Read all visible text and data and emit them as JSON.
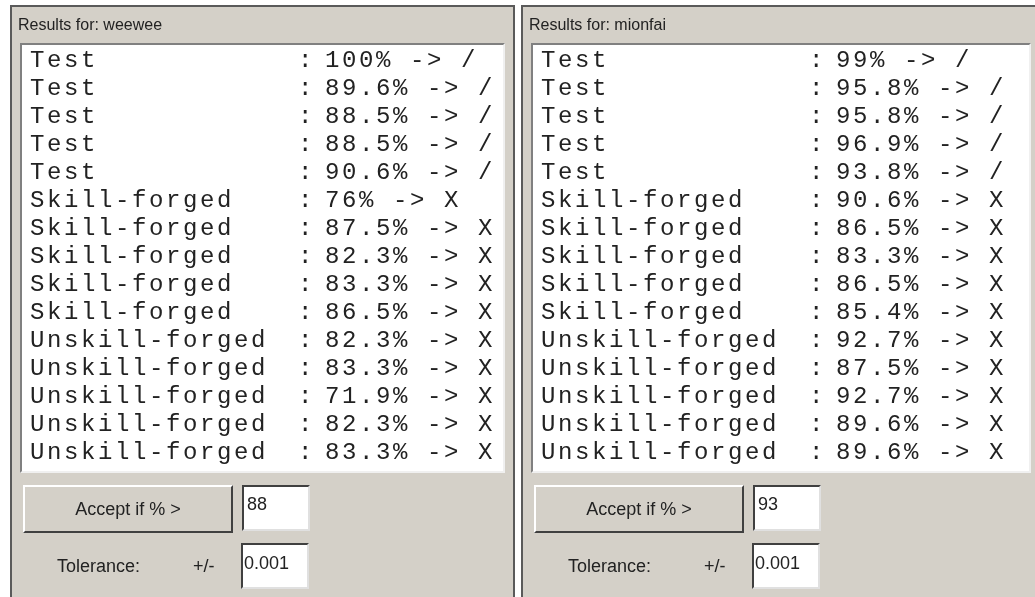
{
  "panels": [
    {
      "title": "Results for: weewee",
      "rows": [
        {
          "label": "Test",
          "separator": ":",
          "value": "100% -> /"
        },
        {
          "label": "Test",
          "separator": ":",
          "value": "89.6% -> /"
        },
        {
          "label": "Test",
          "separator": ":",
          "value": "88.5% -> /"
        },
        {
          "label": "Test",
          "separator": ":",
          "value": "88.5% -> /"
        },
        {
          "label": "Test",
          "separator": ":",
          "value": "90.6% -> /"
        },
        {
          "label": "Skill-forged",
          "separator": ":",
          "value": "76% -> X"
        },
        {
          "label": "Skill-forged",
          "separator": ":",
          "value": "87.5% -> X"
        },
        {
          "label": "Skill-forged",
          "separator": ":",
          "value": "82.3% -> X"
        },
        {
          "label": "Skill-forged",
          "separator": ":",
          "value": "83.3% -> X"
        },
        {
          "label": "Skill-forged",
          "separator": ":",
          "value": "86.5% -> X"
        },
        {
          "label": "Unskill-forged",
          "separator": ":",
          "value": "82.3% -> X"
        },
        {
          "label": "Unskill-forged",
          "separator": ":",
          "value": "83.3% -> X"
        },
        {
          "label": "Unskill-forged",
          "separator": ":",
          "value": "71.9% -> X"
        },
        {
          "label": "Unskill-forged",
          "separator": ":",
          "value": "82.3% -> X"
        },
        {
          "label": "Unskill-forged",
          "separator": ":",
          "value": "83.3% -> X"
        }
      ],
      "accept_button": "Accept if % >",
      "threshold": "88",
      "tolerance_label": "Tolerance:",
      "tolerance_prefix": "+/-",
      "tolerance": "0.001"
    },
    {
      "title": "Results for: mionfai",
      "rows": [
        {
          "label": "Test",
          "separator": ":",
          "value": "99% -> /"
        },
        {
          "label": "Test",
          "separator": ":",
          "value": "95.8% -> /"
        },
        {
          "label": "Test",
          "separator": ":",
          "value": "95.8% -> /"
        },
        {
          "label": "Test",
          "separator": ":",
          "value": "96.9% -> /"
        },
        {
          "label": "Test",
          "separator": ":",
          "value": "93.8% -> /"
        },
        {
          "label": "Skill-forged",
          "separator": ":",
          "value": "90.6% -> X"
        },
        {
          "label": "Skill-forged",
          "separator": ":",
          "value": "86.5% -> X"
        },
        {
          "label": "Skill-forged",
          "separator": ":",
          "value": "83.3% -> X"
        },
        {
          "label": "Skill-forged",
          "separator": ":",
          "value": "86.5% -> X"
        },
        {
          "label": "Skill-forged",
          "separator": ":",
          "value": "85.4% -> X"
        },
        {
          "label": "Unskill-forged",
          "separator": ":",
          "value": "92.7% -> X"
        },
        {
          "label": "Unskill-forged",
          "separator": ":",
          "value": "87.5% -> X"
        },
        {
          "label": "Unskill-forged",
          "separator": ":",
          "value": "92.7% -> X"
        },
        {
          "label": "Unskill-forged",
          "separator": ":",
          "value": "89.6% -> X"
        },
        {
          "label": "Unskill-forged",
          "separator": ":",
          "value": "89.6% -> X"
        }
      ],
      "accept_button": "Accept if % >",
      "threshold": "93",
      "tolerance_label": "Tolerance:",
      "tolerance_prefix": "+/-",
      "tolerance": "0.001"
    }
  ]
}
